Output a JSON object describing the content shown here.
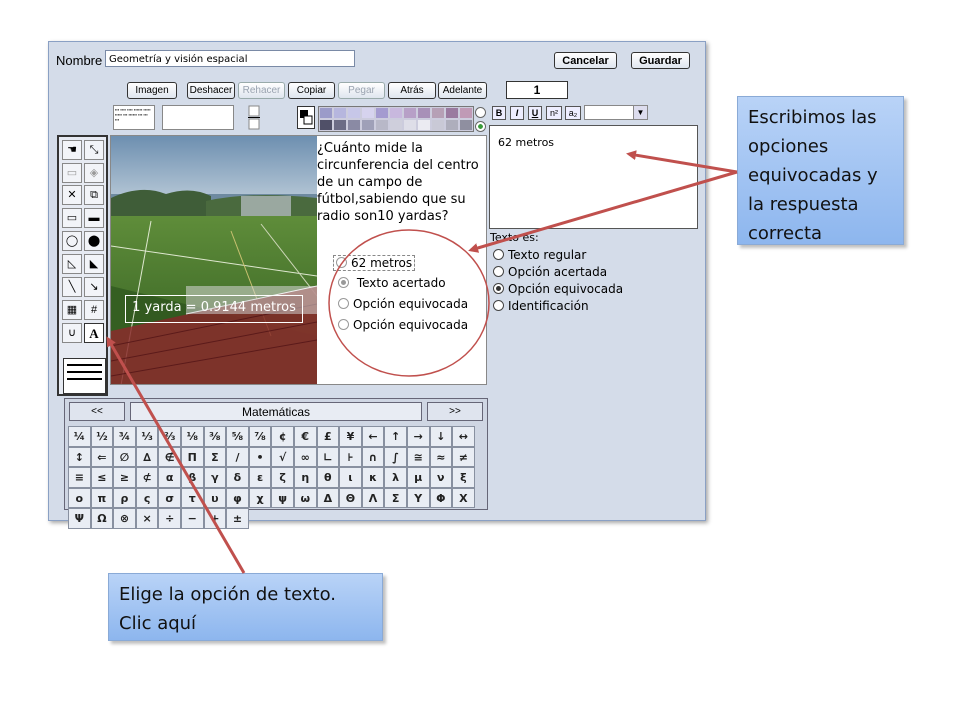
{
  "toolbar": {
    "name_label": "Nombre",
    "name_value": "Geometría y visión espacial",
    "cancel_label": "Cancelar",
    "save_label": "Guardar",
    "image_label": "Imagen",
    "undo_label": "Deshacer",
    "redo_label": "Rehacer",
    "copy_label": "Copiar",
    "paste_label": "Pegar",
    "back_label": "Atrás",
    "forward_label": "Adelante",
    "page_number": "1"
  },
  "format": {
    "bold": "B",
    "italic": "I",
    "underline": "U",
    "superscript": "n²",
    "subscript": "a₂"
  },
  "palette_colors": [
    "#9b9bc9",
    "#b6b6de",
    "#c7c7e8",
    "#d6d3ee",
    "#a49bd0",
    "#c8b8de",
    "#b7a0c7",
    "#a890b8",
    "#b6a0b6",
    "#9a7aa0",
    "#c09ab6",
    "#505068",
    "#6c6c86",
    "#8a8aa4",
    "#9fa0b8",
    "#b8b8c8",
    "#cfcfdc",
    "#dedee8",
    "#ebebf2",
    "#c9c9d6",
    "#aeaebc",
    "#8f8fa0"
  ],
  "question": {
    "text": "¿Cuánto mide la circunferencia del centro de un campo de fútbol,sabiendo que su radio son10 yardas?",
    "options": [
      "62 metros",
      "Texto acertado",
      "Opción equivocada",
      "Opción equivocada"
    ],
    "selected_option_index": 1,
    "photo_label": "1 yarda = 0.9144 metros"
  },
  "editor": {
    "text": "62 metros",
    "type_label": "Texto es:",
    "types": [
      "Texto regular",
      "Opción acertada",
      "Opción equivocada",
      "Identificación"
    ],
    "selected_type_index": 2
  },
  "symbols": {
    "prev": "<<",
    "next": ">>",
    "category": "Matemáticas",
    "items": [
      "¼",
      "½",
      "¾",
      "⅓",
      "⅔",
      "⅛",
      "⅜",
      "⅝",
      "⅞",
      "¢",
      "€",
      "£",
      "¥",
      "←",
      "↑",
      "→",
      "↓",
      "↔",
      "↕",
      "⇐",
      "∅",
      "∆",
      "∉",
      "Π",
      "Σ",
      "/",
      "•",
      "√",
      "∞",
      "∟",
      "⊦",
      "∩",
      "∫",
      "≅",
      "≈",
      "≠",
      "≡",
      "≤",
      "≥",
      "⊄",
      "α",
      "β",
      "γ",
      "δ",
      "ε",
      "ζ",
      "η",
      "θ",
      "ι",
      "κ",
      "λ",
      "μ",
      "ν",
      "ξ",
      "ο",
      "π",
      "ρ",
      "ς",
      "σ",
      "τ",
      "υ",
      "φ",
      "χ",
      "ψ",
      "ω",
      "Δ",
      "Θ",
      "Λ",
      "Σ",
      "Υ",
      "Φ",
      "Χ",
      "Ψ",
      "Ω",
      "⊗",
      "×",
      "÷",
      "−",
      "+",
      "±"
    ]
  },
  "callouts": {
    "right": "Escribimos las opciones equivocadas y la respuesta correcta",
    "bottom": "Elige la opción de texto. Clic aquí"
  },
  "accent_arrow_color": "#c0504d"
}
